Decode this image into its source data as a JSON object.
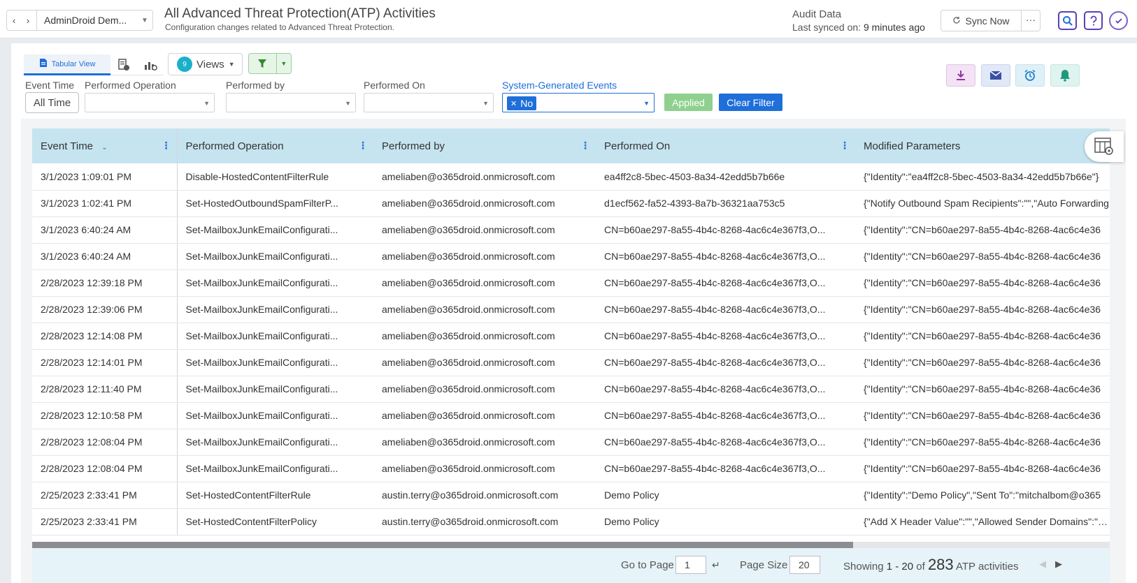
{
  "header": {
    "tenant": "AdminDroid Dem...",
    "title": "All Advanced Threat Protection(ATP) Activities",
    "subtitle": "Configuration changes related to Advanced Threat Protection.",
    "audit_label": "Audit Data",
    "last_synced_prefix": "Last synced on: ",
    "last_synced_value": "9 minutes ago",
    "sync_label": "Sync Now",
    "more_label": "···"
  },
  "toolbar": {
    "tabular_label": "Tabular View",
    "views_count": "9",
    "views_label": "Views"
  },
  "filters": {
    "event_time_label": "Event Time",
    "event_time_value": "All Time",
    "performed_operation_label": "Performed Operation",
    "performed_by_label": "Performed by",
    "performed_on_label": "Performed On",
    "system_generated_label": "System-Generated Events",
    "system_generated_chip": "No",
    "applied_label": "Applied",
    "clear_label": "Clear Filter"
  },
  "table": {
    "columns": [
      "Event Time",
      "Performed Operation",
      "Performed by",
      "Performed On",
      "Modified Parameters"
    ],
    "rows": [
      [
        "3/1/2023 1:09:01 PM",
        "Disable-HostedContentFilterRule",
        "ameliaben@o365droid.onmicrosoft.com",
        "ea4ff2c8-5bec-4503-8a34-42edd5b7b66e",
        "{\"Identity\":\"ea4ff2c8-5bec-4503-8a34-42edd5b7b66e\"}"
      ],
      [
        "3/1/2023 1:02:41 PM",
        "Set-HostedOutboundSpamFilterP...",
        "ameliaben@o365droid.onmicrosoft.com",
        "d1ecf562-fa52-4393-8a7b-36321aa753c5",
        "{\"Notify Outbound Spam Recipients\":\"\",\"Auto Forwarding"
      ],
      [
        "3/1/2023 6:40:24 AM",
        "Set-MailboxJunkEmailConfigurati...",
        "ameliaben@o365droid.onmicrosoft.com",
        "CN=b60ae297-8a55-4b4c-8268-4ac6c4e367f3,O...",
        "{\"Identity\":\"CN=b60ae297-8a55-4b4c-8268-4ac6c4e36"
      ],
      [
        "3/1/2023 6:40:24 AM",
        "Set-MailboxJunkEmailConfigurati...",
        "ameliaben@o365droid.onmicrosoft.com",
        "CN=b60ae297-8a55-4b4c-8268-4ac6c4e367f3,O...",
        "{\"Identity\":\"CN=b60ae297-8a55-4b4c-8268-4ac6c4e36"
      ],
      [
        "2/28/2023 12:39:18 PM",
        "Set-MailboxJunkEmailConfigurati...",
        "ameliaben@o365droid.onmicrosoft.com",
        "CN=b60ae297-8a55-4b4c-8268-4ac6c4e367f3,O...",
        "{\"Identity\":\"CN=b60ae297-8a55-4b4c-8268-4ac6c4e36"
      ],
      [
        "2/28/2023 12:39:06 PM",
        "Set-MailboxJunkEmailConfigurati...",
        "ameliaben@o365droid.onmicrosoft.com",
        "CN=b60ae297-8a55-4b4c-8268-4ac6c4e367f3,O...",
        "{\"Identity\":\"CN=b60ae297-8a55-4b4c-8268-4ac6c4e36"
      ],
      [
        "2/28/2023 12:14:08 PM",
        "Set-MailboxJunkEmailConfigurati...",
        "ameliaben@o365droid.onmicrosoft.com",
        "CN=b60ae297-8a55-4b4c-8268-4ac6c4e367f3,O...",
        "{\"Identity\":\"CN=b60ae297-8a55-4b4c-8268-4ac6c4e36"
      ],
      [
        "2/28/2023 12:14:01 PM",
        "Set-MailboxJunkEmailConfigurati...",
        "ameliaben@o365droid.onmicrosoft.com",
        "CN=b60ae297-8a55-4b4c-8268-4ac6c4e367f3,O...",
        "{\"Identity\":\"CN=b60ae297-8a55-4b4c-8268-4ac6c4e36"
      ],
      [
        "2/28/2023 12:11:40 PM",
        "Set-MailboxJunkEmailConfigurati...",
        "ameliaben@o365droid.onmicrosoft.com",
        "CN=b60ae297-8a55-4b4c-8268-4ac6c4e367f3,O...",
        "{\"Identity\":\"CN=b60ae297-8a55-4b4c-8268-4ac6c4e36"
      ],
      [
        "2/28/2023 12:10:58 PM",
        "Set-MailboxJunkEmailConfigurati...",
        "ameliaben@o365droid.onmicrosoft.com",
        "CN=b60ae297-8a55-4b4c-8268-4ac6c4e367f3,O...",
        "{\"Identity\":\"CN=b60ae297-8a55-4b4c-8268-4ac6c4e36"
      ],
      [
        "2/28/2023 12:08:04 PM",
        "Set-MailboxJunkEmailConfigurati...",
        "ameliaben@o365droid.onmicrosoft.com",
        "CN=b60ae297-8a55-4b4c-8268-4ac6c4e367f3,O...",
        "{\"Identity\":\"CN=b60ae297-8a55-4b4c-8268-4ac6c4e36"
      ],
      [
        "2/28/2023 12:08:04 PM",
        "Set-MailboxJunkEmailConfigurati...",
        "ameliaben@o365droid.onmicrosoft.com",
        "CN=b60ae297-8a55-4b4c-8268-4ac6c4e367f3,O...",
        "{\"Identity\":\"CN=b60ae297-8a55-4b4c-8268-4ac6c4e36"
      ],
      [
        "2/25/2023 2:33:41 PM",
        "Set-HostedContentFilterRule",
        "austin.terry@o365droid.onmicrosoft.com",
        "Demo Policy",
        "{\"Identity\":\"Demo Policy\",\"Sent To\":\"mitchalbom@o365"
      ],
      [
        "2/25/2023 2:33:41 PM",
        "Set-HostedContentFilterPolicy",
        "austin.terry@o365droid.onmicrosoft.com",
        "Demo Policy",
        "{\"Add X Header Value\":\"\",\"Allowed Sender Domains\":\"xm"
      ]
    ]
  },
  "footer": {
    "goto_label": "Go to Page",
    "goto_value": "1",
    "page_size_label": "Page Size",
    "page_size_value": "20",
    "showing_prefix": "Showing ",
    "showing_range": "1 - 20",
    "showing_of": " of ",
    "total": "283",
    "suffix": " ATP activities"
  },
  "colors": {
    "accent": "#1e6fd9",
    "header_row": "#c5e4ef",
    "brand_purple": "#5b3fb8",
    "applied_green": "#8fd08f"
  },
  "icons": [
    "chevron-left-icon",
    "chevron-right-icon",
    "sync-icon",
    "search-icon",
    "help-icon",
    "activity-icon",
    "document-icon",
    "report-icon",
    "chart-icon",
    "filter-icon",
    "download-icon",
    "mail-icon",
    "alarm-icon",
    "bell-icon",
    "column-settings-icon",
    "enter-icon"
  ]
}
